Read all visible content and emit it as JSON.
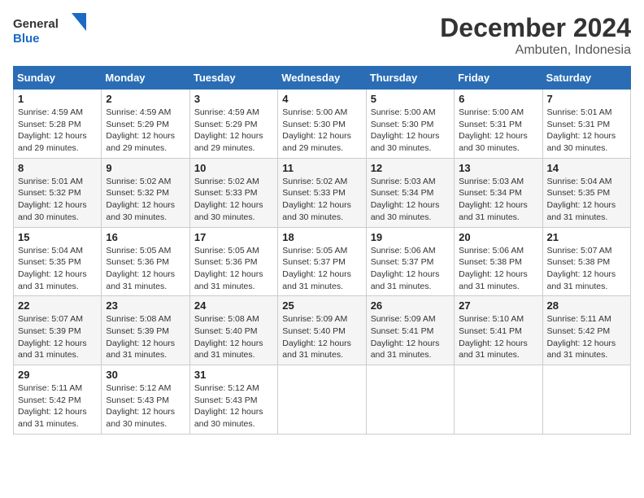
{
  "header": {
    "logo_line1": "General",
    "logo_line2": "Blue",
    "month": "December 2024",
    "location": "Ambuten, Indonesia"
  },
  "weekdays": [
    "Sunday",
    "Monday",
    "Tuesday",
    "Wednesday",
    "Thursday",
    "Friday",
    "Saturday"
  ],
  "weeks": [
    [
      {
        "day": "1",
        "info": "Sunrise: 4:59 AM\nSunset: 5:28 PM\nDaylight: 12 hours\nand 29 minutes."
      },
      {
        "day": "2",
        "info": "Sunrise: 4:59 AM\nSunset: 5:29 PM\nDaylight: 12 hours\nand 29 minutes."
      },
      {
        "day": "3",
        "info": "Sunrise: 4:59 AM\nSunset: 5:29 PM\nDaylight: 12 hours\nand 29 minutes."
      },
      {
        "day": "4",
        "info": "Sunrise: 5:00 AM\nSunset: 5:30 PM\nDaylight: 12 hours\nand 29 minutes."
      },
      {
        "day": "5",
        "info": "Sunrise: 5:00 AM\nSunset: 5:30 PM\nDaylight: 12 hours\nand 30 minutes."
      },
      {
        "day": "6",
        "info": "Sunrise: 5:00 AM\nSunset: 5:31 PM\nDaylight: 12 hours\nand 30 minutes."
      },
      {
        "day": "7",
        "info": "Sunrise: 5:01 AM\nSunset: 5:31 PM\nDaylight: 12 hours\nand 30 minutes."
      }
    ],
    [
      {
        "day": "8",
        "info": "Sunrise: 5:01 AM\nSunset: 5:32 PM\nDaylight: 12 hours\nand 30 minutes."
      },
      {
        "day": "9",
        "info": "Sunrise: 5:02 AM\nSunset: 5:32 PM\nDaylight: 12 hours\nand 30 minutes."
      },
      {
        "day": "10",
        "info": "Sunrise: 5:02 AM\nSunset: 5:33 PM\nDaylight: 12 hours\nand 30 minutes."
      },
      {
        "day": "11",
        "info": "Sunrise: 5:02 AM\nSunset: 5:33 PM\nDaylight: 12 hours\nand 30 minutes."
      },
      {
        "day": "12",
        "info": "Sunrise: 5:03 AM\nSunset: 5:34 PM\nDaylight: 12 hours\nand 30 minutes."
      },
      {
        "day": "13",
        "info": "Sunrise: 5:03 AM\nSunset: 5:34 PM\nDaylight: 12 hours\nand 31 minutes."
      },
      {
        "day": "14",
        "info": "Sunrise: 5:04 AM\nSunset: 5:35 PM\nDaylight: 12 hours\nand 31 minutes."
      }
    ],
    [
      {
        "day": "15",
        "info": "Sunrise: 5:04 AM\nSunset: 5:35 PM\nDaylight: 12 hours\nand 31 minutes."
      },
      {
        "day": "16",
        "info": "Sunrise: 5:05 AM\nSunset: 5:36 PM\nDaylight: 12 hours\nand 31 minutes."
      },
      {
        "day": "17",
        "info": "Sunrise: 5:05 AM\nSunset: 5:36 PM\nDaylight: 12 hours\nand 31 minutes."
      },
      {
        "day": "18",
        "info": "Sunrise: 5:05 AM\nSunset: 5:37 PM\nDaylight: 12 hours\nand 31 minutes."
      },
      {
        "day": "19",
        "info": "Sunrise: 5:06 AM\nSunset: 5:37 PM\nDaylight: 12 hours\nand 31 minutes."
      },
      {
        "day": "20",
        "info": "Sunrise: 5:06 AM\nSunset: 5:38 PM\nDaylight: 12 hours\nand 31 minutes."
      },
      {
        "day": "21",
        "info": "Sunrise: 5:07 AM\nSunset: 5:38 PM\nDaylight: 12 hours\nand 31 minutes."
      }
    ],
    [
      {
        "day": "22",
        "info": "Sunrise: 5:07 AM\nSunset: 5:39 PM\nDaylight: 12 hours\nand 31 minutes."
      },
      {
        "day": "23",
        "info": "Sunrise: 5:08 AM\nSunset: 5:39 PM\nDaylight: 12 hours\nand 31 minutes."
      },
      {
        "day": "24",
        "info": "Sunrise: 5:08 AM\nSunset: 5:40 PM\nDaylight: 12 hours\nand 31 minutes."
      },
      {
        "day": "25",
        "info": "Sunrise: 5:09 AM\nSunset: 5:40 PM\nDaylight: 12 hours\nand 31 minutes."
      },
      {
        "day": "26",
        "info": "Sunrise: 5:09 AM\nSunset: 5:41 PM\nDaylight: 12 hours\nand 31 minutes."
      },
      {
        "day": "27",
        "info": "Sunrise: 5:10 AM\nSunset: 5:41 PM\nDaylight: 12 hours\nand 31 minutes."
      },
      {
        "day": "28",
        "info": "Sunrise: 5:11 AM\nSunset: 5:42 PM\nDaylight: 12 hours\nand 31 minutes."
      }
    ],
    [
      {
        "day": "29",
        "info": "Sunrise: 5:11 AM\nSunset: 5:42 PM\nDaylight: 12 hours\nand 31 minutes."
      },
      {
        "day": "30",
        "info": "Sunrise: 5:12 AM\nSunset: 5:43 PM\nDaylight: 12 hours\nand 30 minutes."
      },
      {
        "day": "31",
        "info": "Sunrise: 5:12 AM\nSunset: 5:43 PM\nDaylight: 12 hours\nand 30 minutes."
      },
      null,
      null,
      null,
      null
    ]
  ]
}
